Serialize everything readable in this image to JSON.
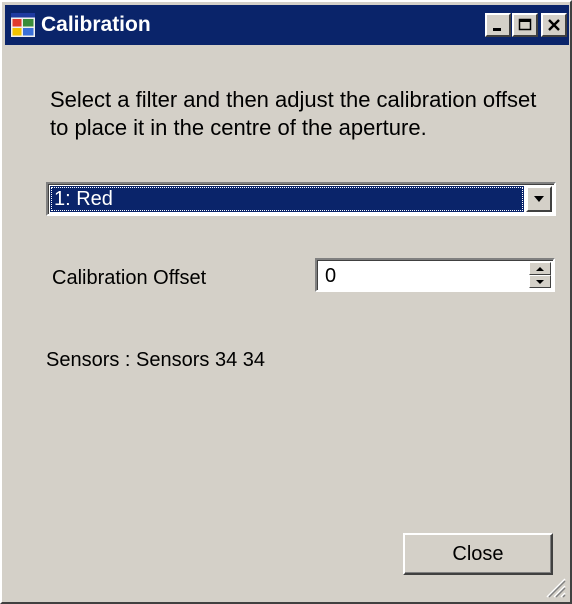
{
  "window": {
    "title": "Calibration",
    "app_icon": "app-window-icon",
    "caption_buttons": [
      "minimize-icon",
      "maximize-icon",
      "close-icon"
    ]
  },
  "instructions": "Select a filter and then adjust the calibration offset to place it in the centre of the aperture.",
  "filter_select": {
    "selected": "1: Red",
    "arrow_icon": "chevron-down-icon"
  },
  "offset": {
    "label": "Calibration Offset",
    "value": "0"
  },
  "sensors_text": "Sensors : Sensors 34 34",
  "buttons": {
    "close_label": "Close"
  },
  "colors": {
    "title_bar": "#0a246a",
    "dialog_bg": "#d4d0c8",
    "selection": "#0a246a"
  }
}
